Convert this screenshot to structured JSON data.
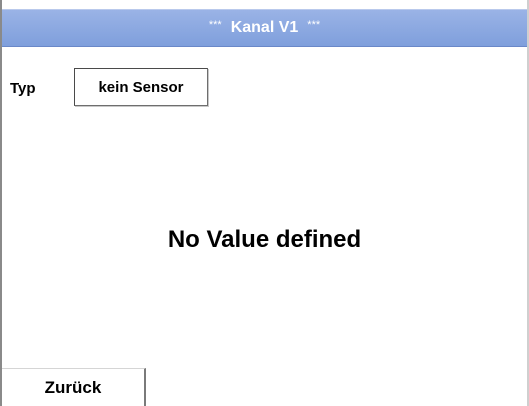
{
  "header": {
    "title": "Kanal V1",
    "stars_left": "***",
    "stars_right": "***"
  },
  "type_field": {
    "label": "Typ",
    "value": "kein Sensor"
  },
  "main": {
    "message": "No Value defined"
  },
  "footer": {
    "back_label": "Zurück"
  },
  "colors": {
    "title_bar": "#86a3df",
    "background": "#ffffff"
  }
}
